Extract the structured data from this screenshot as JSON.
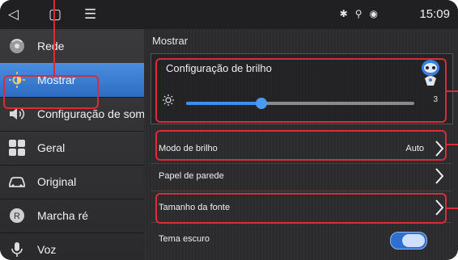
{
  "status_bar": {
    "nav_icons": [
      "back-icon",
      "home-icon",
      "menu-icon"
    ],
    "status_icons": [
      "bluetooth-icon",
      "location-icon",
      "wifi-icon"
    ],
    "time": "15:09"
  },
  "sidebar": {
    "items": [
      {
        "label": "Rede",
        "icon": "network-icon",
        "active": false
      },
      {
        "label": "Mostrar",
        "icon": "brightness-icon",
        "active": true
      },
      {
        "label": "Configuração de som",
        "icon": "speaker-icon",
        "active": false
      },
      {
        "label": "Geral",
        "icon": "grid-icon",
        "active": false
      },
      {
        "label": "Original",
        "icon": "car-icon",
        "active": false
      },
      {
        "label": "Marcha ré",
        "icon": "reverse-icon",
        "active": false
      },
      {
        "label": "Voz",
        "icon": "microphone-icon",
        "active": false
      }
    ]
  },
  "main": {
    "section_title": "Mostrar",
    "brightness": {
      "title": "Configuração de brilho",
      "icon": "sun-icon",
      "value": "3",
      "level_fraction": 0.33
    },
    "rows": [
      {
        "label": "Modo de brilho",
        "value": "Auto"
      },
      {
        "label": "Papel de parede",
        "value": ""
      },
      {
        "label": "Tamanho da fonte",
        "value": ""
      },
      {
        "label": "Tema escuro",
        "toggle_on": true
      }
    ]
  },
  "colors": {
    "accent": "#3d8ef0",
    "highlight": "#d92b3a",
    "active_item": "#2d6cc3"
  }
}
